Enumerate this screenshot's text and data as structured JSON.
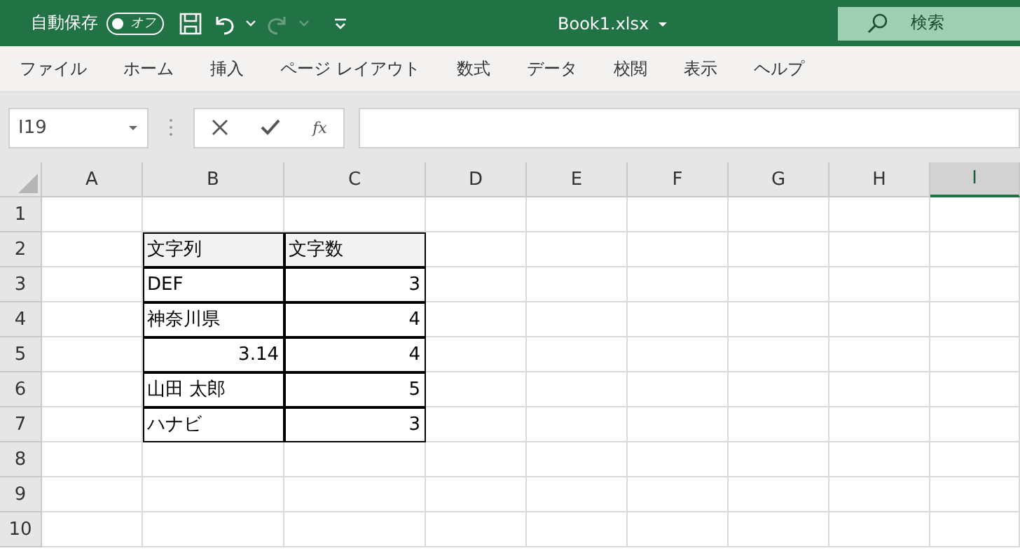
{
  "title_bar": {
    "autosave_label": "自動保存",
    "autosave_toggle": {
      "label": "オフ",
      "on": false
    },
    "file_name": "Book1.xlsx",
    "search": {
      "placeholder": "検索"
    }
  },
  "ribbon_tabs": [
    {
      "label": "ファイル"
    },
    {
      "label": "ホーム"
    },
    {
      "label": "挿入"
    },
    {
      "label": "ページ レイアウト"
    },
    {
      "label": "数式"
    },
    {
      "label": "データ"
    },
    {
      "label": "校閲"
    },
    {
      "label": "表示"
    },
    {
      "label": "ヘルプ"
    }
  ],
  "formula_bar": {
    "name_box": "I19",
    "function_label": "fx"
  },
  "sheet": {
    "columns": [
      {
        "label": "A",
        "selected": false
      },
      {
        "label": "B",
        "selected": false
      },
      {
        "label": "C",
        "selected": false
      },
      {
        "label": "D",
        "selected": false
      },
      {
        "label": "E",
        "selected": false
      },
      {
        "label": "F",
        "selected": false
      },
      {
        "label": "G",
        "selected": false
      },
      {
        "label": "H",
        "selected": false
      },
      {
        "label": "I",
        "selected": true
      }
    ],
    "rows": [
      {
        "label": "1",
        "cells": []
      },
      {
        "label": "2",
        "cells": [
          {
            "text": "文字列",
            "kind": "header"
          },
          {
            "text": "文字数",
            "kind": "header"
          }
        ]
      },
      {
        "label": "3",
        "cells": [
          {
            "text": "DEF",
            "kind": "text"
          },
          {
            "text": "3",
            "kind": "number"
          }
        ]
      },
      {
        "label": "4",
        "cells": [
          {
            "text": "神奈川県",
            "kind": "text"
          },
          {
            "text": "4",
            "kind": "number"
          }
        ]
      },
      {
        "label": "5",
        "cells": [
          {
            "text": "3.14",
            "kind": "number"
          },
          {
            "text": "4",
            "kind": "number"
          }
        ]
      },
      {
        "label": "6",
        "cells": [
          {
            "text": "山田 太郎",
            "kind": "text"
          },
          {
            "text": "5",
            "kind": "number"
          }
        ]
      },
      {
        "label": "7",
        "cells": [
          {
            "text": "ハナビ",
            "kind": "text"
          },
          {
            "text": "3",
            "kind": "number"
          }
        ]
      },
      {
        "label": "8",
        "cells": []
      },
      {
        "label": "9",
        "cells": []
      },
      {
        "label": "10",
        "cells": []
      }
    ]
  }
}
